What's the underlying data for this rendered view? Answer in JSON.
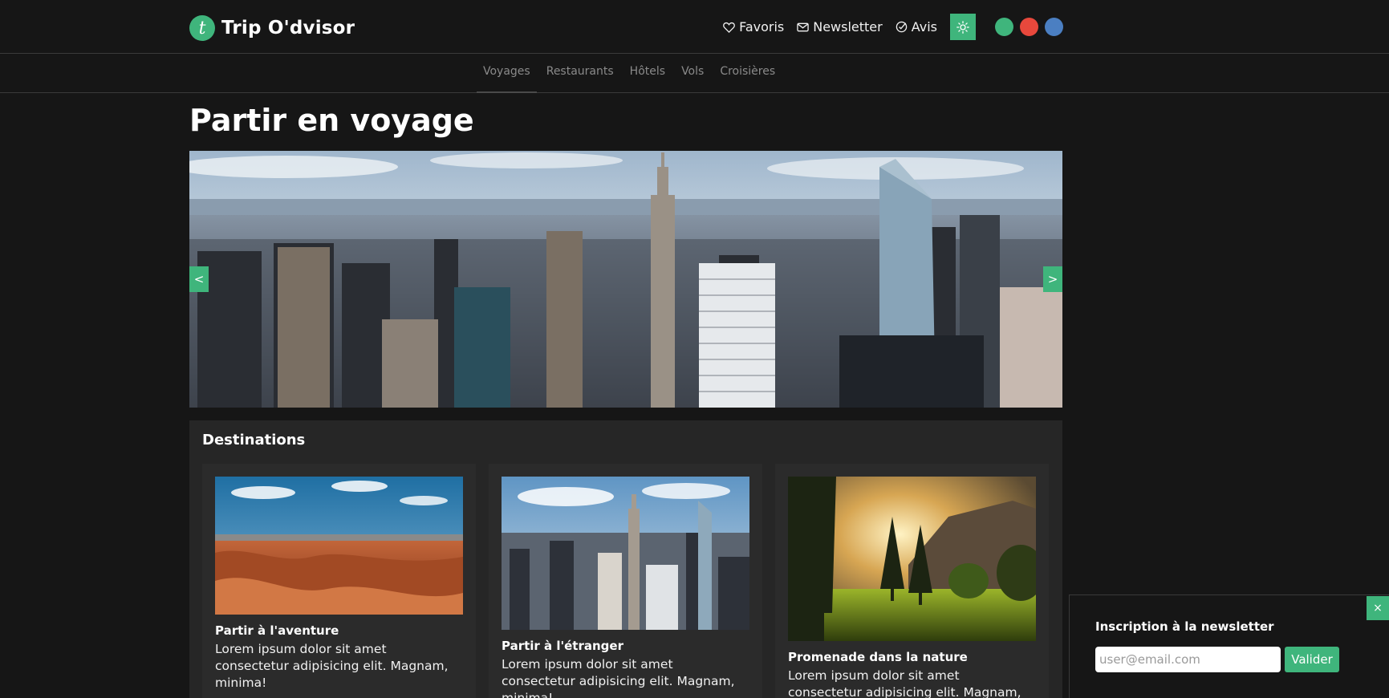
{
  "brand": {
    "logo_letter": "t",
    "name": "Trip O'dvisor"
  },
  "topnav": {
    "favorites": "Favoris",
    "newsletter": "Newsletter",
    "reviews": "Avis"
  },
  "theme_colors": [
    "#3fb57c",
    "#e8483c",
    "#4b7fc2"
  ],
  "accent_color": "#3fb57c",
  "subnav": {
    "items": [
      "Voyages",
      "Restaurants",
      "Hôtels",
      "Vols",
      "Croisières"
    ],
    "active": "Voyages"
  },
  "page": {
    "title": "Partir en voyage"
  },
  "carousel": {
    "prev_label": "<",
    "next_label": ">"
  },
  "destinations": {
    "title": "Destinations",
    "cards": [
      {
        "title": "Partir à l'aventure",
        "text": "Lorem ipsum dolor sit amet consectetur adipisicing elit. Magnam, minima!"
      },
      {
        "title": "Partir à l'étranger",
        "text": "Lorem ipsum dolor sit amet consectetur adipisicing elit. Magnam, minima!"
      },
      {
        "title": "Promenade dans la nature",
        "text": "Lorem ipsum dolor sit amet consectetur adipisicing elit. Magnam, minima!"
      }
    ]
  },
  "newsletter_popup": {
    "close_label": "×",
    "title": "Inscription à la newsletter",
    "email_placeholder": "user@email.com",
    "submit_label": "Valider"
  }
}
